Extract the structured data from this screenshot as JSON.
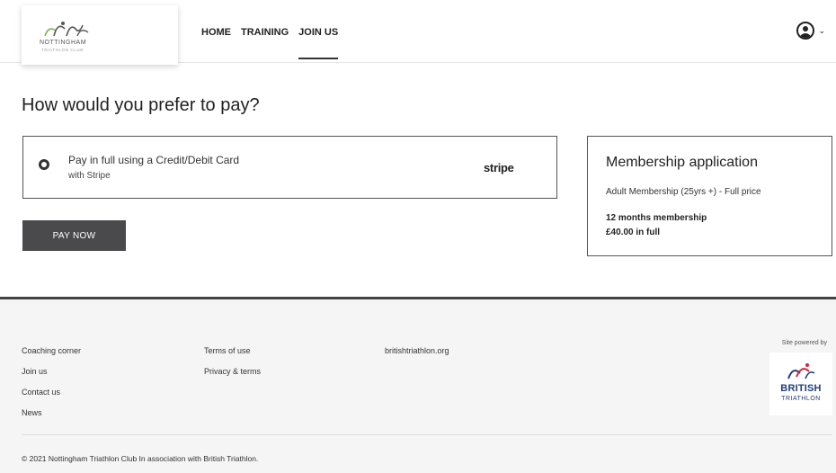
{
  "header": {
    "logo": {
      "name": "NOTTINGHAM",
      "subtitle": "TRIATHLON CLUB",
      "icon": "triathlon-swirl-logo"
    },
    "nav": [
      {
        "label": "HOME",
        "active": false
      },
      {
        "label": "TRAINING",
        "active": false
      },
      {
        "label": "JOIN US",
        "active": true
      }
    ],
    "user_menu": {
      "icon": "user-circle-icon",
      "chevron": "chevron-down-icon"
    }
  },
  "main": {
    "heading": "How would you prefer to pay?",
    "payment_option": {
      "title": "Pay in full using a Credit/Debit Card",
      "subtitle": "with Stripe",
      "provider": "stripe",
      "selected": true
    },
    "pay_button": "PAY NOW",
    "summary": {
      "title": "Membership application",
      "line": "Adult Membership (25yrs +) - Full price",
      "duration": "12 months membership",
      "price": "£40.00 in full"
    }
  },
  "footer": {
    "col1": [
      "Coaching corner",
      "Join us",
      "Contact us",
      "News"
    ],
    "col2": [
      "Terms of use",
      "Privacy & terms"
    ],
    "col3": [
      "britishtriathlon.org"
    ],
    "powered_by": "Site powered by",
    "bt_logo": {
      "name": "BRITISH",
      "sub": "TRIATHLON"
    },
    "copyright": "© 2021 Nottingham Triathlon Club In association with British Triathlon."
  },
  "colors": {
    "button": "#4a4a4d",
    "footer_bg": "#f5f5f5",
    "bt_blue": "#1e3e7a",
    "bt_red": "#d0243b"
  }
}
